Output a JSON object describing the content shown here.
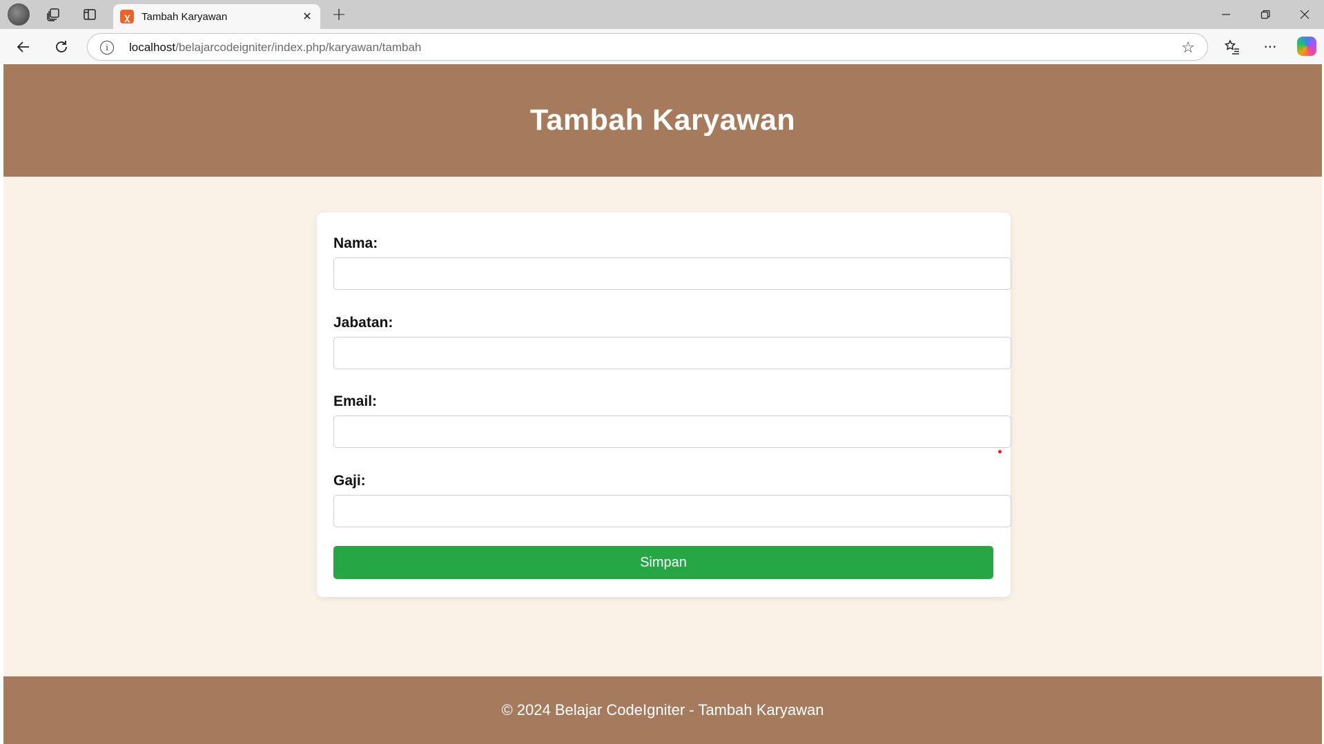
{
  "browser": {
    "tab_title": "Tambah Karyawan",
    "tab_favicon": "xampp-icon",
    "url_host": "localhost",
    "url_path": "/belajarcodeigniter/index.php/karyawan/tambah"
  },
  "header": {
    "title": "Tambah Karyawan"
  },
  "form": {
    "fields": [
      {
        "label": "Nama:",
        "value": ""
      },
      {
        "label": "Jabatan:",
        "value": ""
      },
      {
        "label": "Email:",
        "value": ""
      },
      {
        "label": "Gaji:",
        "value": ""
      }
    ],
    "submit_label": "Simpan"
  },
  "footer": {
    "text": "© 2024 Belajar CodeIgniter - Tambah Karyawan"
  },
  "colors": {
    "header_bg": "#a67b5d",
    "page_bg": "#fbf2e7",
    "button_bg": "#26a645"
  }
}
